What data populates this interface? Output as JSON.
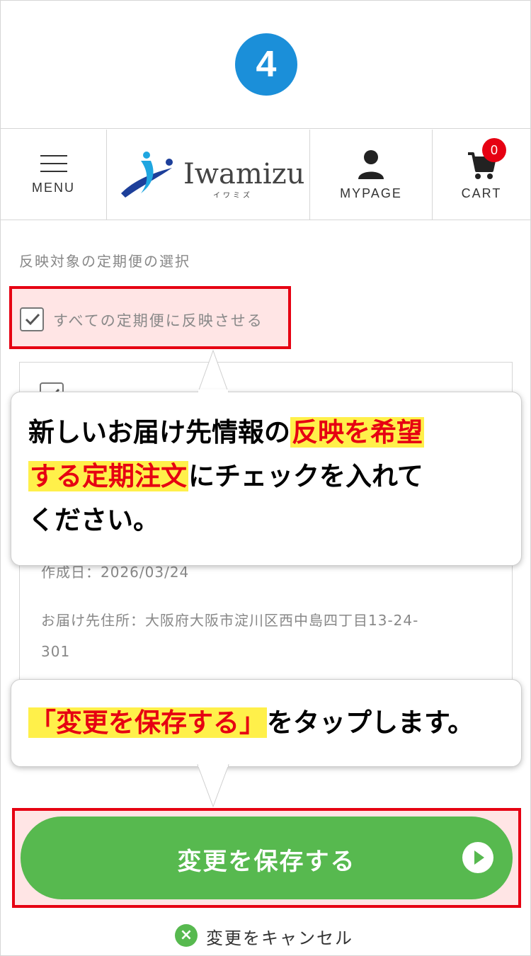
{
  "step": {
    "number": "4"
  },
  "header": {
    "menu_label": "MENU",
    "logo_text": "Iwamizu",
    "logo_sub": "イワミズ",
    "mypage_label": "MYPAGE",
    "cart_label": "CART",
    "cart_count": "0"
  },
  "form": {
    "section_title": "反映対象の定期便の選択",
    "apply_all_label": "すべての定期便に反映させる",
    "apply_all_checked": true
  },
  "card": {
    "created_date": "作成日：2026/03/24",
    "address_line1": "お届け先住所：大阪府大阪市淀川区西中島四丁目13-24-",
    "address_line2": "301"
  },
  "callouts": {
    "first": {
      "part1": "新しいお届け先情報の",
      "highlight1": "反映を希望",
      "highlight2": "する定期注文",
      "part2": "にチェックを入れて",
      "part3": "ください。"
    },
    "second": {
      "highlight": "「変更を保存する」",
      "part": "をタップします。"
    }
  },
  "actions": {
    "save_label": "変更を保存する",
    "cancel_label": "変更をキャンセル"
  },
  "colors": {
    "step_blue": "#1b8fd9",
    "accent_green": "#57b94f",
    "highlight_red": "#e60012",
    "highlight_yellow": "#fff04a"
  }
}
